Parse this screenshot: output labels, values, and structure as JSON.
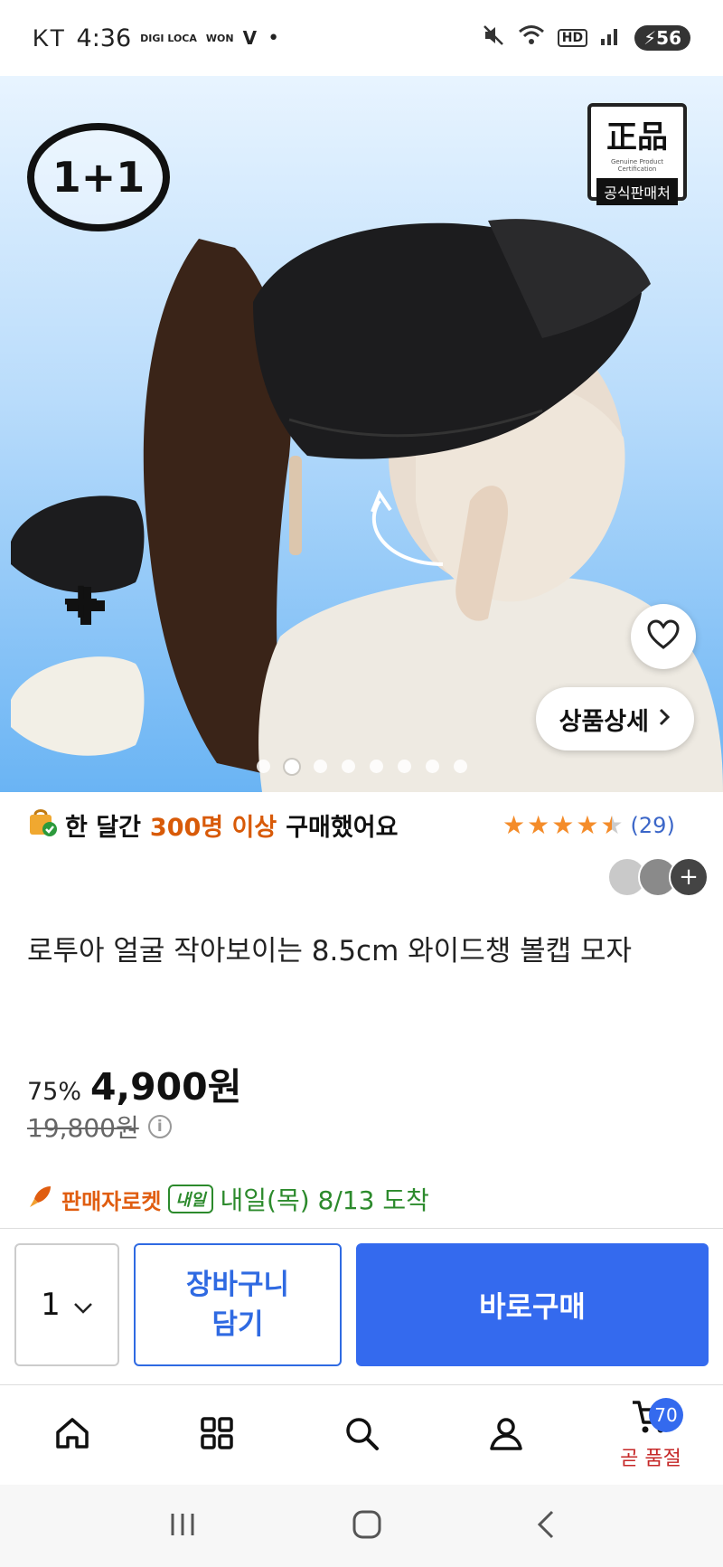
{
  "status_bar": {
    "carrier": "KT",
    "time": "4:36",
    "indicator_1": "DIGI LOCA",
    "indicator_2": "WON",
    "indicator_3": "V",
    "battery": "56",
    "network": "HD"
  },
  "hero": {
    "promo_badge": "1+1",
    "genuine_badge_title": "正品",
    "genuine_badge_small": "Genuine Product Certification",
    "genuine_badge_caption": "공식판매처",
    "plus_sign": "+",
    "detail_button": "상품상세",
    "carousel": {
      "total": 8,
      "active_index": 1
    }
  },
  "purchase_info": {
    "prefix": "한 달간",
    "highlight": "300명 이상",
    "suffix": "구매했어요"
  },
  "rating": {
    "stars": 4.5,
    "count_text": "(29)"
  },
  "reviews_more_icon": "+",
  "product": {
    "title": "로투아 얼굴 작아보이는 8.5cm 와이드챙 볼캡 모자",
    "discount": "75%",
    "price": "4,900원",
    "original_price": "19,800원"
  },
  "delivery": {
    "rocket_label": "판매자로켓",
    "tag": "내일",
    "text": "내일(목) 8/13 도착"
  },
  "actions": {
    "quantity": "1",
    "cart_line1": "장바구니",
    "cart_line2": "담기",
    "buy": "바로구매"
  },
  "bottom_nav": {
    "cart_count": "70",
    "cart_label": "곧 품절"
  },
  "colors": {
    "accent_blue": "#346aee",
    "orange_highlight": "#d85a08",
    "delivery_green": "#2c8a2c",
    "star_orange": "#f48c2a",
    "soldout_red": "#c62828"
  }
}
